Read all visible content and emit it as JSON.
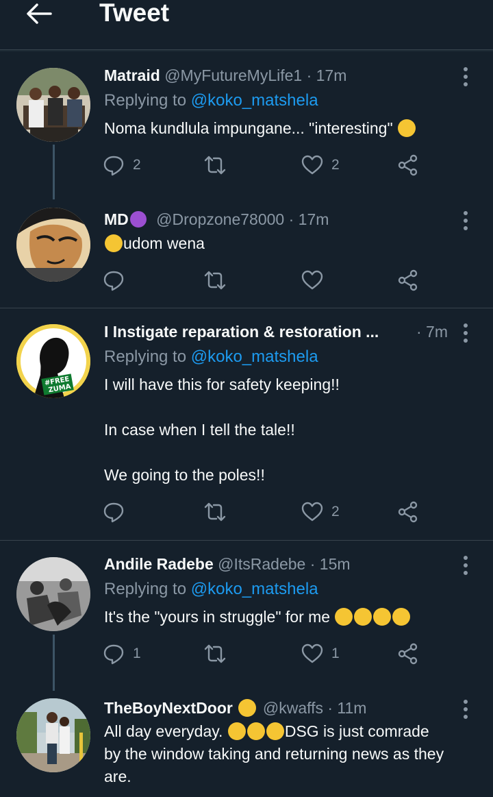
{
  "header": {
    "title": "Tweet"
  },
  "colors": {
    "background": "#15202b",
    "text": "#f7f9f9",
    "muted": "#8b98a5",
    "link": "#1d9bf0",
    "divider": "#38444d"
  },
  "tweets": [
    {
      "name": "Matraid",
      "handle": "@MyFutureMyLife1",
      "time": "· 17m",
      "replying_prefix": "Replying to ",
      "replying_to": "@koko_matshela",
      "text": "Noma kundlula impungane... \"interesting\"",
      "replies": "2",
      "retweets": "",
      "likes": "2"
    },
    {
      "name": "MD",
      "handle": "@Dropzone78000",
      "time": "· 17m",
      "text": "udom wena",
      "replies": "",
      "retweets": "",
      "likes": ""
    },
    {
      "name": "I Instigate reparation & restoration ...",
      "handle": "",
      "time": "· 7m",
      "replying_prefix": "Replying to ",
      "replying_to": "@koko_matshela",
      "text_lines": [
        "I will have this for safety keeping!!",
        "In case when I tell the tale!!",
        "We going to the poles!!"
      ],
      "avatar_badge": [
        "#FREE",
        "ZUMA"
      ],
      "replies": "",
      "retweets": "",
      "likes": "2"
    },
    {
      "name": "Andile Radebe",
      "handle": "@ItsRadebe",
      "time": "· 15m",
      "replying_prefix": "Replying to ",
      "replying_to": "@koko_matshela",
      "text": "It's the \"yours in struggle\" for me",
      "replies": "1",
      "retweets": "",
      "likes": "1"
    },
    {
      "name": "TheBoyNextDoor",
      "handle": "@kwaffs",
      "time": "· 11m",
      "text_a": "All day everyday.",
      "text_b": "DSG is just comrade",
      "text_c": "by the window taking and returning news as they",
      "text_d": "are."
    }
  ]
}
